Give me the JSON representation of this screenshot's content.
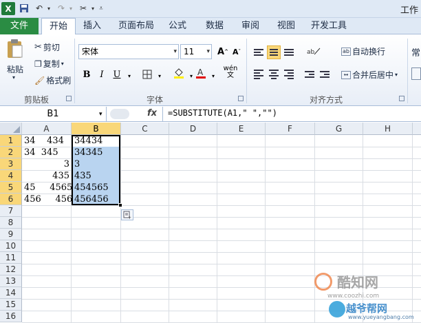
{
  "app": {
    "icon_label": "X",
    "window_title": "工作"
  },
  "qat": {
    "icons": [
      "save-icon",
      "undo-icon",
      "redo-icon",
      "customize-icon"
    ]
  },
  "tabs": [
    "文件",
    "开始",
    "插入",
    "页面布局",
    "公式",
    "数据",
    "审阅",
    "视图",
    "开发工具"
  ],
  "ribbon": {
    "clipboard": {
      "paste": "粘贴",
      "cut": "剪切",
      "copy": "复制",
      "format_painter": "格式刷",
      "label": "剪贴板"
    },
    "font": {
      "name": "宋体",
      "size": "11",
      "bold": "B",
      "italic": "I",
      "underline": "U",
      "wen": "wén",
      "label": "字体"
    },
    "alignment": {
      "wrap": "自动换行",
      "merge": "合并后居中",
      "label": "对齐方式"
    },
    "number": {
      "general": "常"
    }
  },
  "formula_bar": {
    "name_box": "B1",
    "fx": "fx",
    "formula": "=SUBSTITUTE(A1,\" \",\"\")"
  },
  "columns": [
    "A",
    "B",
    "C",
    "D",
    "E",
    "F",
    "G",
    "H"
  ],
  "rows": [
    "1",
    "2",
    "3",
    "4",
    "5",
    "6",
    "7",
    "8",
    "9",
    "10",
    "11",
    "12",
    "13",
    "14",
    "15",
    "16"
  ],
  "cells_a": [
    "34    434",
    "34  345",
    "3",
    "435",
    "45     4565",
    "456     456"
  ],
  "cells_b": [
    "34434",
    "34345",
    "3",
    "435",
    "454565",
    "456456"
  ],
  "watermark": {
    "top": "酷知网",
    "top_sub": "www.coozhi.com",
    "bottom": "越爷帮网",
    "bottom_sub": "www.yueyangbang.com"
  }
}
